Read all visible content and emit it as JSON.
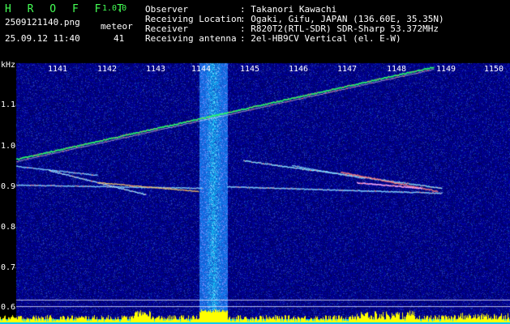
{
  "header": {
    "app_title": "H R O F F T",
    "version": "1.0.0",
    "filename": "2509121140.png",
    "meteor_label": "meteor",
    "datetime": "25.09.12 11:40",
    "meteor_count": "41",
    "info": [
      {
        "label": "Observer",
        "value": ": Takanori Kawachi"
      },
      {
        "label": "Receiving Location",
        "value": ": Ogaki, Gifu, JAPAN (136.60E, 35.35N)"
      },
      {
        "label": "Receiver",
        "value": ": R820T2(RTL-SDR) SDR-Sharp 53.372MHz"
      },
      {
        "label": "Receiving antenna",
        "value": ": 2el-HB9CV Vertical (el. E-W)"
      }
    ]
  },
  "axes": {
    "y_unit": "kHz",
    "y_ticks": [
      "1.1",
      "1.0",
      "0.9",
      "0.8",
      "0.7",
      "0.6"
    ],
    "x_ticks": [
      "1141",
      "1142",
      "1143",
      "1144",
      "1145",
      "1146",
      "1147",
      "1148",
      "1149",
      "1150"
    ]
  },
  "colors": {
    "header_green": "#44ff55",
    "background_noise": "#0a1a9a",
    "strong_band": "#3a8aff",
    "meteor_trace": "#2aff6a",
    "level_bars": "#ffff00",
    "level_base": "#00c8ff"
  }
}
